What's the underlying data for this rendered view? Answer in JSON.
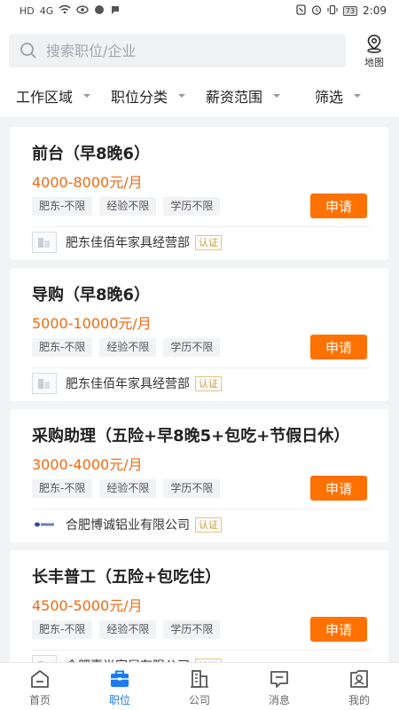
{
  "status_bar": {
    "left_icons": [
      "HD",
      "4G",
      "wifi",
      "eye",
      "cloud",
      "chat"
    ],
    "battery": "73",
    "time": "2:09"
  },
  "search": {
    "placeholder": "搜索职位/企业",
    "map_label": "地图"
  },
  "filters": [
    {
      "label": "工作区域"
    },
    {
      "label": "职位分类"
    },
    {
      "label": "薪资范围"
    },
    {
      "label": "筛选"
    }
  ],
  "jobs": [
    {
      "title": "前台（早8晚6）",
      "salary": "4000-8000元/月",
      "tags": [
        "肥东-不限",
        "经验不限",
        "学历不限"
      ],
      "apply_label": "申请",
      "company": "肥东佳佰年家具经营部",
      "verified": "认证"
    },
    {
      "title": "导购（早8晚6）",
      "salary": "5000-10000元/月",
      "tags": [
        "肥东-不限",
        "经验不限",
        "学历不限"
      ],
      "apply_label": "申请",
      "company": "肥东佳佰年家具经营部",
      "verified": "认证"
    },
    {
      "title": "采购助理（五险+早8晚5+包吃+节假日休）",
      "salary": "3000-4000元/月",
      "tags": [
        "肥东-不限",
        "经验不限",
        "学历不限"
      ],
      "apply_label": "申请",
      "company": "合肥博诚铝业有限公司",
      "verified": "认证"
    },
    {
      "title": "长丰普工（五险+包吃住）",
      "salary": "4500-5000元/月",
      "tags": [
        "肥东-不限",
        "经验不限",
        "学历不限"
      ],
      "apply_label": "申请",
      "company": "合肥嘉尚家居有限公司",
      "verified": "认证"
    }
  ],
  "nav": [
    {
      "label": "首页",
      "icon": "home-icon"
    },
    {
      "label": "职位",
      "icon": "briefcase-icon",
      "active": true
    },
    {
      "label": "公司",
      "icon": "building-icon"
    },
    {
      "label": "消息",
      "icon": "message-icon"
    },
    {
      "label": "我的",
      "icon": "profile-icon"
    }
  ],
  "colors": {
    "accent": "#ff7100",
    "salary": "#ef6a12",
    "nav_active": "#1a7cf0"
  }
}
